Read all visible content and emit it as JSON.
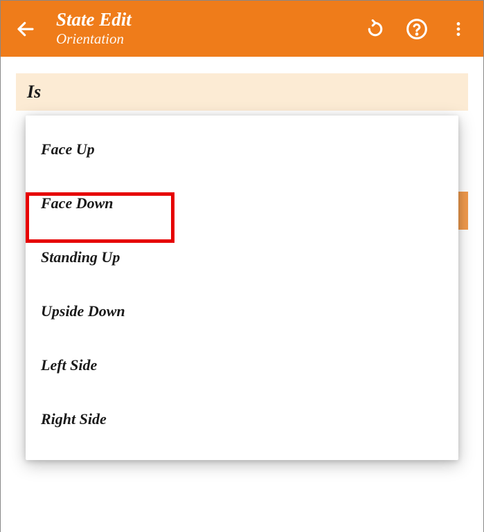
{
  "header": {
    "title": "State Edit",
    "subtitle": "Orientation"
  },
  "section": {
    "label": "Is"
  },
  "options": [
    "Face Up",
    "Face Down",
    "Standing Up",
    "Upside Down",
    "Left Side",
    "Right Side"
  ]
}
